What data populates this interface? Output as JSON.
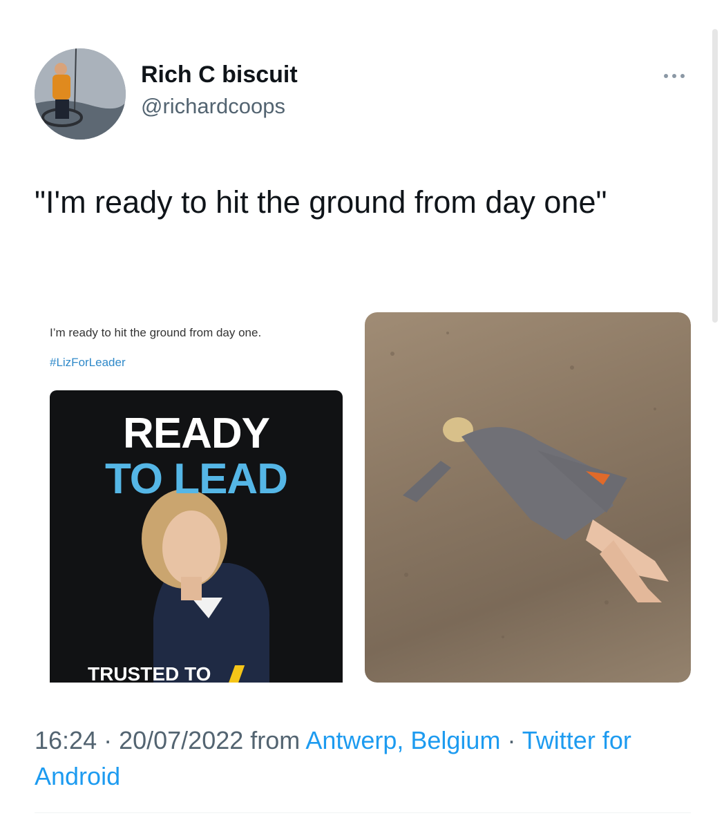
{
  "tweet": {
    "display_name": "Rich C biscuit",
    "handle": "@richardcoops",
    "text": "\"I'm ready to hit the ground from day one\"",
    "time": "16:24",
    "separator": " · ",
    "date": "20/07/2022",
    "from_word": " from ",
    "location": "Antwerp, Belgium",
    "source": "Twitter for Android"
  },
  "media": {
    "embedded_tweet_text": "I’m ready to hit the ground from day one.",
    "embedded_hashtag": "#LizForLeader",
    "poster_line1": "READY",
    "poster_line2": "TO LEAD",
    "poster_footer": "TRUSTED TO"
  },
  "colors": {
    "link": "#1d9bf0",
    "secondary_text": "#536471",
    "poster_accent": "#55b6e6",
    "poster_slash": "#f5c518"
  },
  "icons": {
    "more": "more-dots-icon"
  }
}
